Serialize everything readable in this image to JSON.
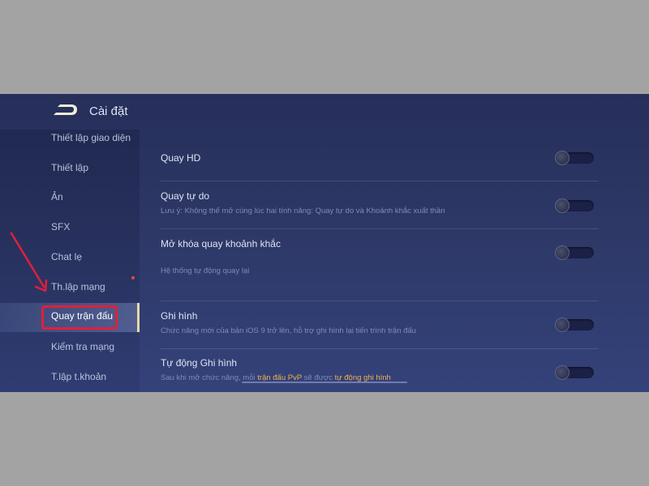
{
  "header": {
    "title": "Cài đặt"
  },
  "sidebar": {
    "items": [
      {
        "label": "Thiết lập giao diện"
      },
      {
        "label": "Thiết lập"
      },
      {
        "label": "Ản"
      },
      {
        "label": "SFX"
      },
      {
        "label": "Chat lẹ"
      },
      {
        "label": "Th.lập mạng"
      },
      {
        "label": "Quay trận đấu",
        "active": true
      },
      {
        "label": "Kiểm tra mạng"
      },
      {
        "label": "T.lập t.khoản"
      }
    ]
  },
  "settings": {
    "rows": [
      {
        "title": "Quay HD",
        "toggle_on": false
      },
      {
        "title": "Quay tự do",
        "desc": "Lưu ý: Không thể mở cùng lúc hai tính năng: Quay tự do và Khoảnh khắc xuất thần",
        "toggle_on": false
      },
      {
        "title": "Mở khóa quay khoảnh khắc",
        "desc": "Hệ thống tự động quay lại",
        "toggle_on": false
      },
      {
        "title": "Ghi hình",
        "desc": "Chức năng mới của bản iOS 9 trở lên, hỗ trợ ghi hình lại tiến trình trận đấu",
        "toggle_on": false
      },
      {
        "title": "Tự động Ghi hình",
        "desc_prefix": "Sau khi mở chức năng, mỗi ",
        "desc_hl1": "trận đấu PvP",
        "desc_mid": " sẽ được ",
        "desc_hl2": "tự động ghi hình",
        "toggle_on": false
      }
    ]
  },
  "colors": {
    "annotation_red": "#e11f3c",
    "highlight_text": "#f0b24a",
    "background": "#2d3866"
  }
}
